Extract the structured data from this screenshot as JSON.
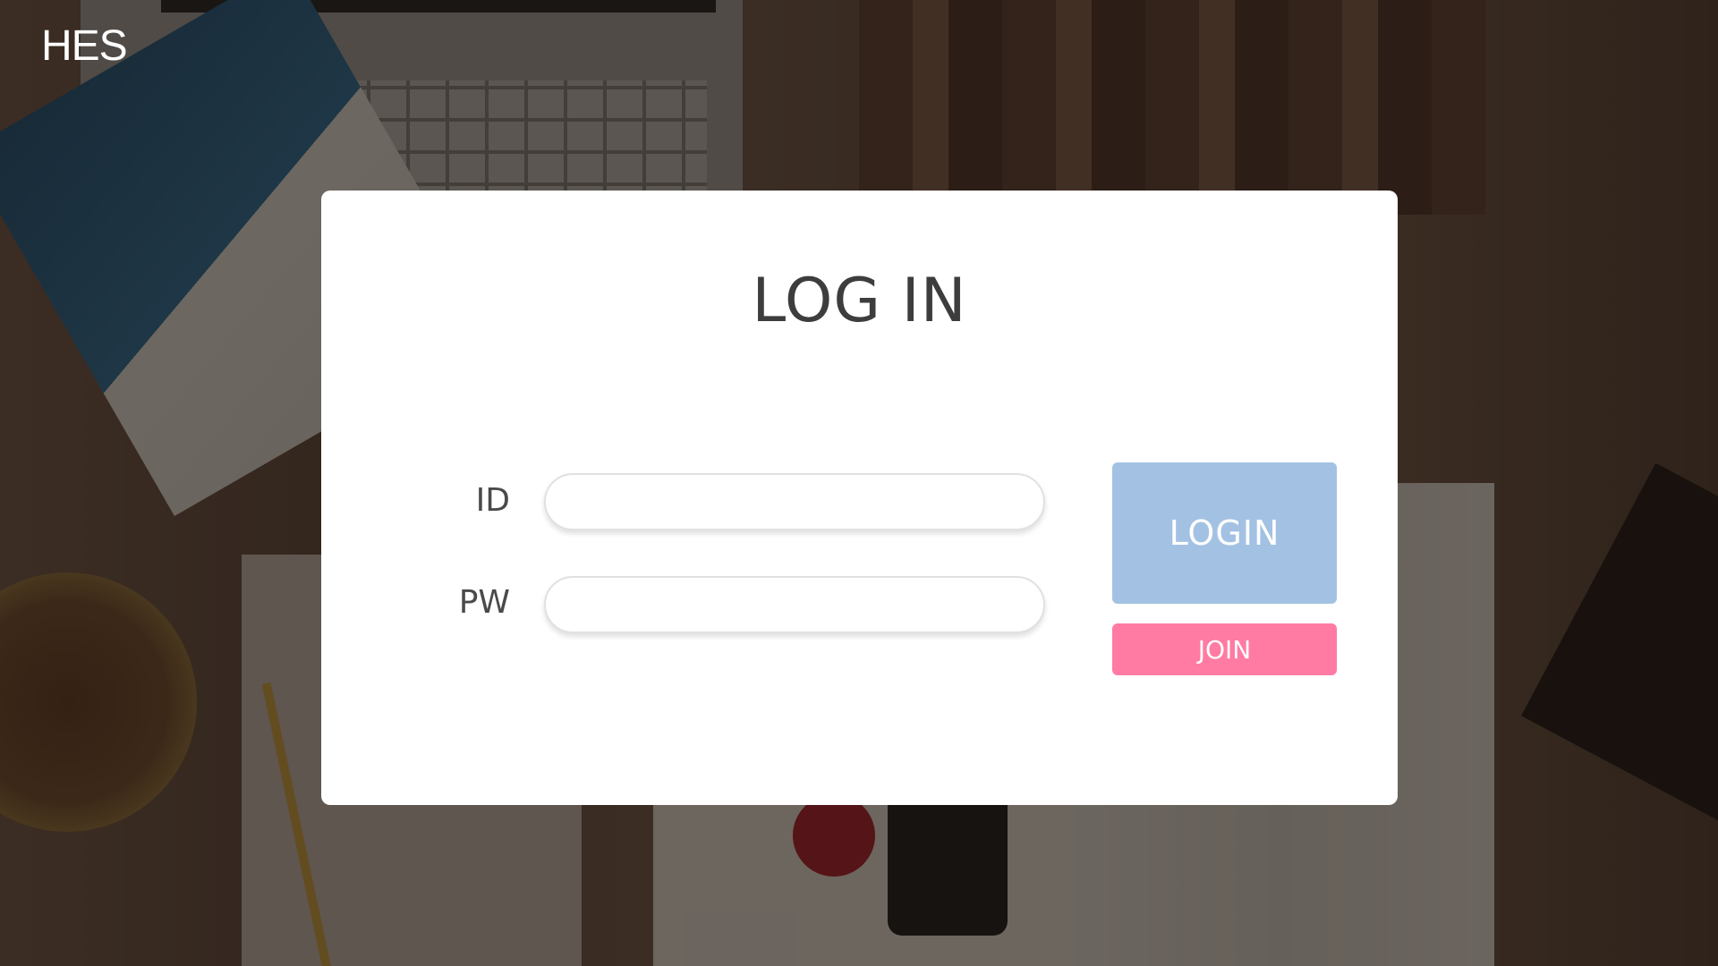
{
  "brand": {
    "logo_text": "HES"
  },
  "login_card": {
    "title": "LOG IN",
    "id_label": "ID",
    "pw_label": "PW",
    "id_value": "",
    "pw_value": "",
    "login_button": "LOGIN",
    "join_button": "JOIN"
  },
  "colors": {
    "login_button": "#a3c2e3",
    "join_button": "#ff7ba3",
    "card_background": "#ffffff"
  }
}
